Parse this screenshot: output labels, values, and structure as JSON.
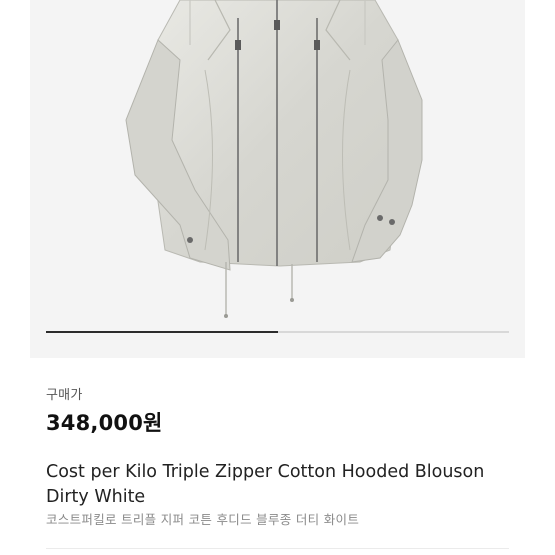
{
  "product": {
    "price_label": "구매가",
    "price": "348,000원",
    "title_line1": "Cost per Kilo Triple Zipper Cotton Hooded Blouson",
    "title_line2": "Dirty White",
    "subtitle_ko": "코스트퍼킬로 트리플 지퍼 코튼 후디드 블루종 더티 화이트"
  },
  "gallery": {
    "image_name": "jacket-photo",
    "progress": 0.5
  },
  "colors": {
    "image_bg": "#f4f4f4",
    "jacket": "#dcdcd6",
    "progress": "#2b2b2b"
  }
}
